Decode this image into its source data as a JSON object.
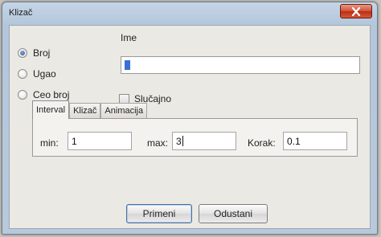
{
  "window": {
    "title": "Klizač"
  },
  "type_options": [
    {
      "label": "Broj",
      "checked": true
    },
    {
      "label": "Ugao",
      "checked": false
    },
    {
      "label": "Ceo broj",
      "checked": false
    }
  ],
  "name": {
    "label": "Ime",
    "value": ""
  },
  "random": {
    "label": "Slučajno",
    "checked": false
  },
  "tabs": [
    {
      "label": "Interval",
      "active": true
    },
    {
      "label": "Klizač",
      "active": false
    },
    {
      "label": "Animacija",
      "active": false
    }
  ],
  "interval": {
    "min_label": "min:",
    "min_value": "1",
    "max_label": "max:",
    "max_value": "3",
    "step_label": "Korak:",
    "step_value": "0.1"
  },
  "buttons": {
    "apply": "Primeni",
    "cancel": "Odustani"
  },
  "icons": {
    "close": "close-icon"
  }
}
